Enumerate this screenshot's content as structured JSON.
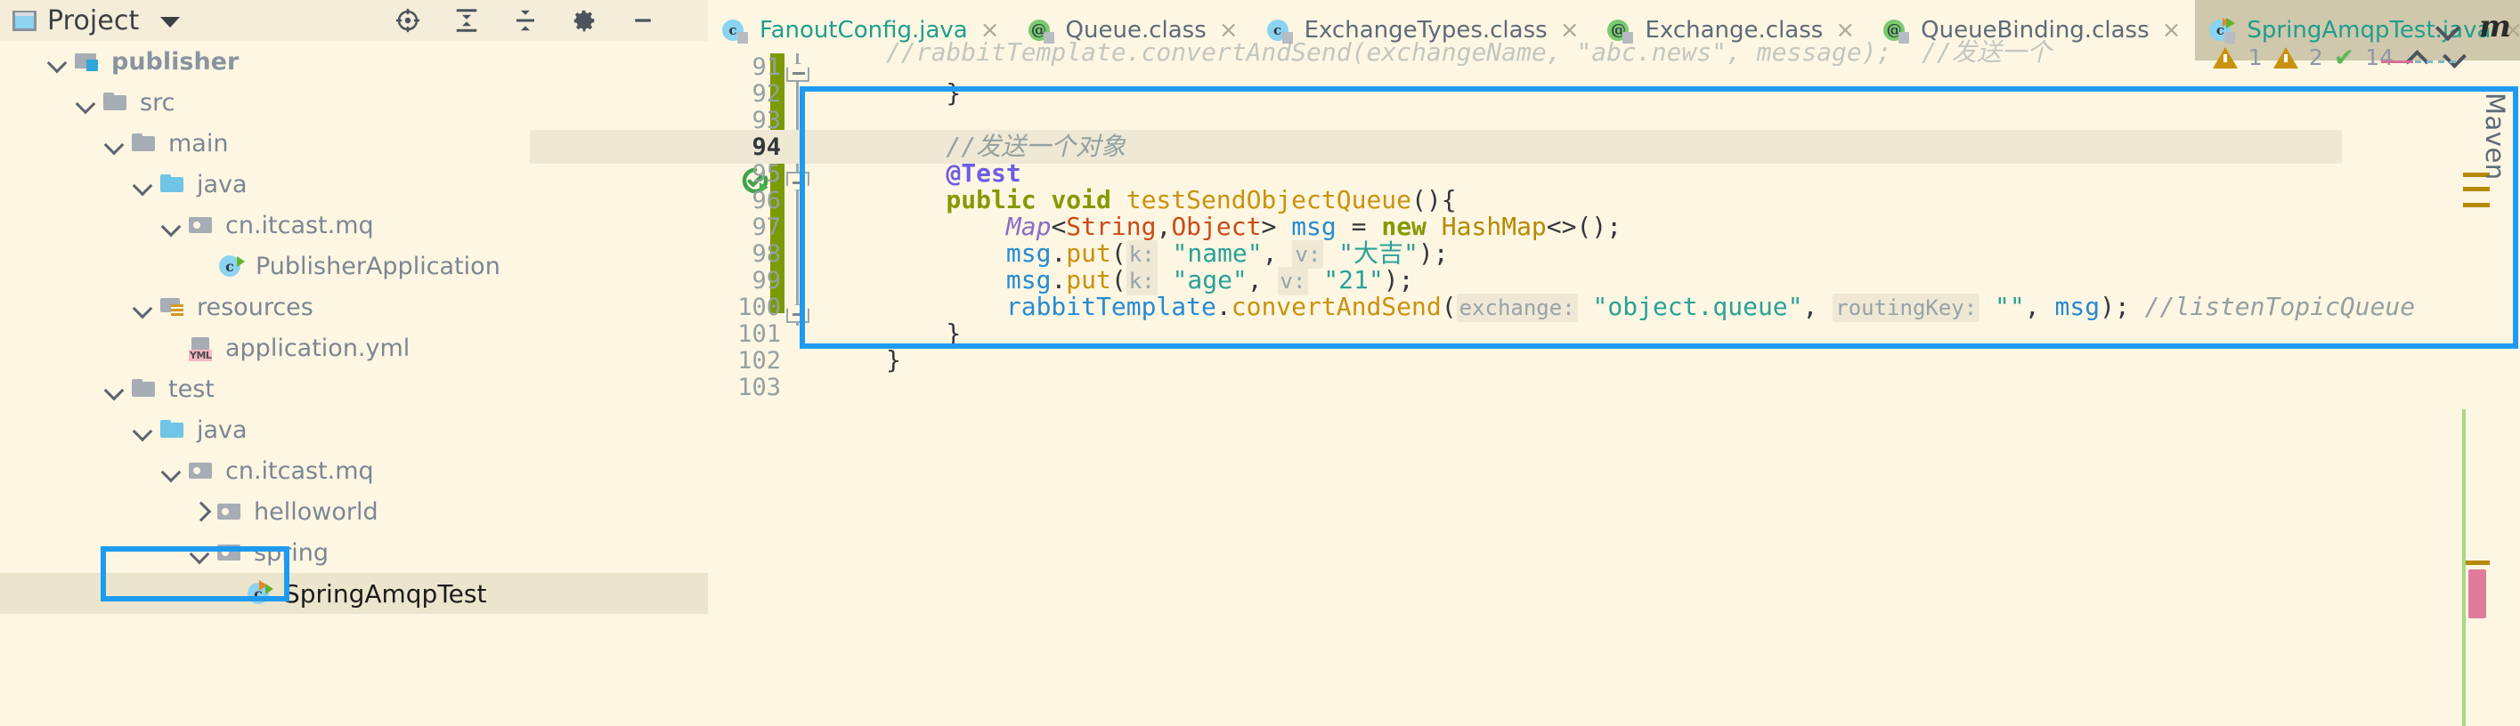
{
  "sidebar": {
    "title": "Project",
    "icons": [
      "project-icon",
      "chevron-down-icon",
      "locate-target-icon",
      "expand-all-icon",
      "collapse-all-icon",
      "gear-icon",
      "minimize-icon"
    ],
    "tree": [
      {
        "label": "publisher",
        "indent": 52,
        "arrow": "down",
        "icon": "module-icon",
        "bold": true
      },
      {
        "label": "src",
        "indent": 84,
        "arrow": "down",
        "icon": "folder-icon",
        "bold": false
      },
      {
        "label": "main",
        "indent": 116,
        "arrow": "down",
        "icon": "folder-icon",
        "bold": false
      },
      {
        "label": "java",
        "indent": 148,
        "arrow": "down",
        "icon": "source-folder-icon",
        "bold": false
      },
      {
        "label": "cn.itcast.mq",
        "indent": 180,
        "arrow": "down",
        "icon": "package-icon",
        "bold": false
      },
      {
        "label": "PublisherApplication",
        "indent": 212,
        "arrow": "none",
        "icon": "java-class-run-icon",
        "bold": false
      },
      {
        "label": "resources",
        "indent": 148,
        "arrow": "down",
        "icon": "resources-folder-icon",
        "bold": false
      },
      {
        "label": "application.yml",
        "indent": 180,
        "arrow": "none",
        "icon": "yml-file-icon",
        "bold": false
      },
      {
        "label": "test",
        "indent": 116,
        "arrow": "down",
        "icon": "folder-icon",
        "bold": false
      },
      {
        "label": "java",
        "indent": 148,
        "arrow": "down",
        "icon": "source-folder-icon",
        "bold": false
      },
      {
        "label": "cn.itcast.mq",
        "indent": 180,
        "arrow": "down",
        "icon": "package-icon",
        "bold": false
      },
      {
        "label": "helloworld",
        "indent": 212,
        "arrow": "right",
        "icon": "package-icon",
        "bold": false
      },
      {
        "label": "spring",
        "indent": 212,
        "arrow": "down",
        "icon": "package-icon",
        "bold": false
      },
      {
        "label": "SpringAmqpTest",
        "indent": 244,
        "arrow": "none",
        "icon": "java-test-class-icon",
        "bold": false,
        "selected": true
      }
    ]
  },
  "editor": {
    "tabs": [
      {
        "label": "FanoutConfig.java",
        "icon": "java-class-icon",
        "active": false,
        "teal": true
      },
      {
        "label": "Queue.class",
        "icon": "annotation-class-icon",
        "active": false,
        "teal": false
      },
      {
        "label": "ExchangeTypes.class",
        "icon": "java-class-icon",
        "active": false,
        "teal": false
      },
      {
        "label": "Exchange.class",
        "icon": "annotation-class-icon",
        "active": false,
        "teal": false
      },
      {
        "label": "QueueBinding.class",
        "icon": "annotation-class-icon",
        "active": false,
        "teal": false
      },
      {
        "label": "SpringAmqpTest.java",
        "icon": "java-test-class-icon",
        "active": true,
        "teal": true
      }
    ],
    "tab_close_glyph": "×",
    "tabs_overflow_icon": "chevron-down-icon",
    "inspections": {
      "warning_count_1": "1",
      "warning_count_2": "2",
      "ok_count": "14",
      "ok_glyph": "✔",
      "nav_up_icon": "chevron-up-icon",
      "nav_down_icon": "chevron-down-icon"
    },
    "line_numbers": [
      "91",
      "92",
      "93",
      "94",
      "95",
      "96",
      "97",
      "98",
      "99",
      "100",
      "101",
      "102",
      "103"
    ],
    "current_line": "94",
    "gutter_icons": [
      "run-test-icon",
      "fold-marker-icon"
    ],
    "lines": [
      {
        "n": "91",
        "tokens": [
          {
            "t": "//rabbitTemplate.convertAndSend(exchangeName, ",
            "c": "tok-cm"
          },
          {
            "t": "\"abc.news\"",
            "c": "tok-cm-str"
          },
          {
            "t": ", message);",
            "c": "tok-cm"
          },
          {
            "t": "  //发送一个",
            "c": "tok-cm"
          }
        ]
      },
      {
        "n": "92",
        "tokens": [
          {
            "t": "    }",
            "c": "tok-def"
          }
        ]
      },
      {
        "n": "93",
        "tokens": [
          {
            "t": "",
            "c": "tok-def"
          }
        ]
      },
      {
        "n": "94",
        "tokens": [
          {
            "t": "    //发送一个对象",
            "c": "tok-cm"
          }
        ]
      },
      {
        "n": "95",
        "tokens": [
          {
            "t": "    @Test",
            "c": "tok-anno"
          }
        ]
      },
      {
        "n": "96",
        "tokens": [
          {
            "t": "    public void ",
            "c": "tok-kw"
          },
          {
            "t": "testSendObjectQueue",
            "c": "tok-mth"
          },
          {
            "t": "(){",
            "c": "tok-def"
          }
        ]
      },
      {
        "n": "97",
        "tokens": [
          {
            "t": "        ",
            "c": "tok-def"
          },
          {
            "t": "Map",
            "c": "tok-itf"
          },
          {
            "t": "<",
            "c": "tok-def"
          },
          {
            "t": "String",
            "c": "tok-cls"
          },
          {
            "t": ",",
            "c": "tok-def"
          },
          {
            "t": "Object",
            "c": "tok-cls"
          },
          {
            "t": "> ",
            "c": "tok-def"
          },
          {
            "t": "msg",
            "c": "tok-var"
          },
          {
            "t": " = ",
            "c": "tok-def"
          },
          {
            "t": "new ",
            "c": "tok-kw"
          },
          {
            "t": "HashMap",
            "c": "tok-cls2"
          },
          {
            "t": "<>();",
            "c": "tok-def"
          }
        ]
      },
      {
        "n": "98",
        "tokens": [
          {
            "t": "        ",
            "c": "tok-def"
          },
          {
            "t": "msg",
            "c": "tok-var"
          },
          {
            "t": ".",
            "c": "tok-def"
          },
          {
            "t": "put",
            "c": "tok-mth"
          },
          {
            "t": "(",
            "c": "tok-def"
          },
          {
            "t": "k:",
            "c": "hint"
          },
          {
            "t": " \"name\"",
            "c": "tok-str"
          },
          {
            "t": ", ",
            "c": "tok-def"
          },
          {
            "t": "v:",
            "c": "hint"
          },
          {
            "t": " \"大吉\"",
            "c": "tok-str"
          },
          {
            "t": ");",
            "c": "tok-def"
          }
        ]
      },
      {
        "n": "99",
        "tokens": [
          {
            "t": "        ",
            "c": "tok-def"
          },
          {
            "t": "msg",
            "c": "tok-var"
          },
          {
            "t": ".",
            "c": "tok-def"
          },
          {
            "t": "put",
            "c": "tok-mth"
          },
          {
            "t": "(",
            "c": "tok-def"
          },
          {
            "t": "k:",
            "c": "hint"
          },
          {
            "t": " \"age\"",
            "c": "tok-str"
          },
          {
            "t": ", ",
            "c": "tok-def"
          },
          {
            "t": "v:",
            "c": "hint"
          },
          {
            "t": " \"21\"",
            "c": "tok-str"
          },
          {
            "t": ");",
            "c": "tok-def"
          }
        ]
      },
      {
        "n": "100",
        "tokens": [
          {
            "t": "        ",
            "c": "tok-def"
          },
          {
            "t": "rabbitTemplate",
            "c": "tok-var"
          },
          {
            "t": ".",
            "c": "tok-def"
          },
          {
            "t": "convertAndSend",
            "c": "tok-mth"
          },
          {
            "t": "(",
            "c": "tok-def"
          },
          {
            "t": "exchange:",
            "c": "hint"
          },
          {
            "t": " \"object.queue\"",
            "c": "tok-str"
          },
          {
            "t": ", ",
            "c": "tok-def"
          },
          {
            "t": "routingKey:",
            "c": "hint"
          },
          {
            "t": " \"\"",
            "c": "tok-str"
          },
          {
            "t": ", ",
            "c": "tok-def"
          },
          {
            "t": "msg",
            "c": "tok-var"
          },
          {
            "t": "); ",
            "c": "tok-def"
          },
          {
            "t": "//listenTopicQueue",
            "c": "tok-cm"
          }
        ]
      },
      {
        "n": "101",
        "tokens": [
          {
            "t": "    }",
            "c": "tok-def"
          }
        ]
      },
      {
        "n": "102",
        "tokens": [
          {
            "t": "}",
            "c": "tok-def"
          }
        ]
      },
      {
        "n": "103",
        "tokens": [
          {
            "t": "",
            "c": "tok-def"
          }
        ]
      }
    ]
  },
  "right_panel": {
    "maven_label": "Maven",
    "maven_glyph": "m"
  },
  "colors": {
    "highlight_box": "#1e9bf0",
    "background": "#fdf6e3",
    "caret_line": "#eee8d5",
    "change_bar": "#7b9a00",
    "active_tab": "#cfc8ac",
    "teal_text": "#1f9e8e"
  }
}
